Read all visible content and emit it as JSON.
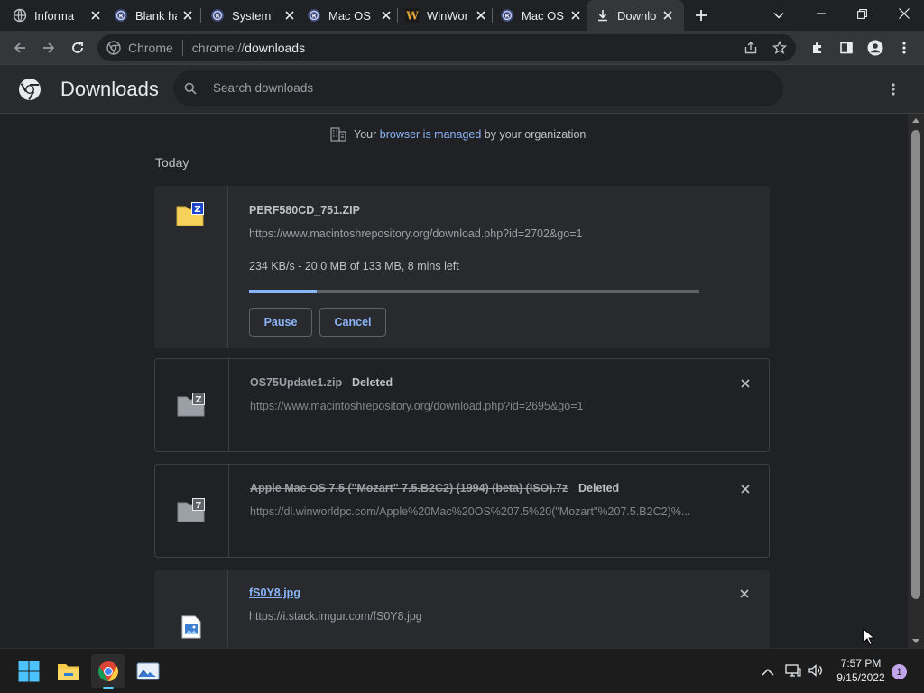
{
  "tabs": [
    {
      "title": "Informa",
      "icon": "globe-icon"
    },
    {
      "title": "Blank ha",
      "icon": "macintosh-repository-icon"
    },
    {
      "title": "System",
      "icon": "macintosh-repository-icon"
    },
    {
      "title": "Mac OS",
      "icon": "macintosh-repository-icon"
    },
    {
      "title": "WinWor",
      "icon": "winworld-icon"
    },
    {
      "title": "Mac OS",
      "icon": "macintosh-repository-icon"
    },
    {
      "title": "Downlo",
      "icon": "download-icon",
      "active": true
    }
  ],
  "omnibox": {
    "site_label": "Chrome",
    "url_prefix": "chrome://",
    "url_path": "downloads"
  },
  "header": {
    "title": "Downloads",
    "search_placeholder": "Search downloads"
  },
  "managed_notice": {
    "prefix": "Your ",
    "link": "browser is managed",
    "suffix": " by your organization"
  },
  "section_label": "Today",
  "downloads": [
    {
      "name": "PERF580CD_751.ZIP",
      "url": "https://www.macintoshrepository.org/download.php?id=2702&go=1",
      "progress_text": "234 KB/s - 20.0 MB of 133 MB, 8 mins left",
      "progress": 0.15,
      "pause_label": "Pause",
      "cancel_label": "Cancel"
    },
    {
      "name": "OS75Update1.zip",
      "status": "Deleted",
      "url": "https://www.macintoshrepository.org/download.php?id=2695&go=1"
    },
    {
      "name": "Apple Mac OS 7.5 (\"Mozart\" 7.5.B2C2) (1994) (beta) (ISO).7z",
      "status": "Deleted",
      "url": "https://dl.winworldpc.com/Apple%20Mac%20OS%207.5%20(\"Mozart\"%207.5.B2C2)%..."
    },
    {
      "name": "fS0Y8.jpg",
      "url": "https://i.stack.imgur.com/fS0Y8.jpg"
    }
  ],
  "taskbar": {
    "time": "7:57 PM",
    "date": "9/15/2022",
    "notification_count": "1"
  },
  "colors": {
    "accent": "#8ab4f8",
    "background": "#202124",
    "progress": "#8ab4f8"
  }
}
